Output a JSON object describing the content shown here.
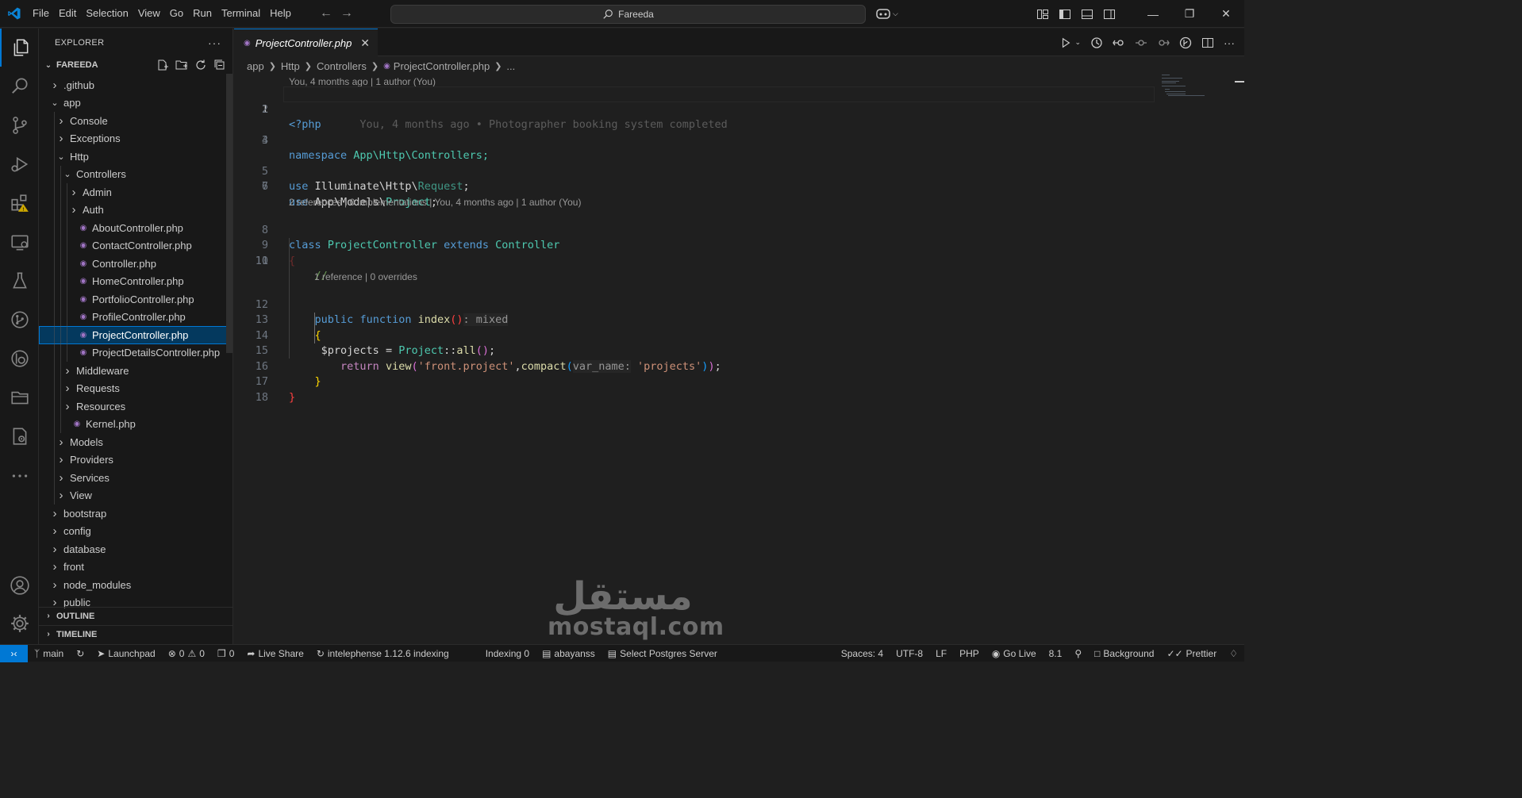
{
  "titlebar": {
    "menu": [
      "File",
      "Edit",
      "Selection",
      "View",
      "Go",
      "Run",
      "Terminal",
      "Help"
    ],
    "search_text": "Fareeda"
  },
  "sidebar": {
    "title": "EXPLORER",
    "root": "FAREEDA",
    "tree": [
      {
        "label": ".github",
        "depth": 1,
        "kind": "folder",
        "open": false
      },
      {
        "label": "app",
        "depth": 1,
        "kind": "folder",
        "open": true
      },
      {
        "label": "Console",
        "depth": 2,
        "kind": "folder",
        "open": false
      },
      {
        "label": "Exceptions",
        "depth": 2,
        "kind": "folder",
        "open": false
      },
      {
        "label": "Http",
        "depth": 2,
        "kind": "folder",
        "open": true
      },
      {
        "label": "Controllers",
        "depth": 3,
        "kind": "folder",
        "open": true
      },
      {
        "label": "Admin",
        "depth": 4,
        "kind": "folder",
        "open": false
      },
      {
        "label": "Auth",
        "depth": 4,
        "kind": "folder",
        "open": false
      },
      {
        "label": "AboutController.php",
        "depth": 4,
        "kind": "php"
      },
      {
        "label": "ContactController.php",
        "depth": 4,
        "kind": "php"
      },
      {
        "label": "Controller.php",
        "depth": 4,
        "kind": "php"
      },
      {
        "label": "HomeController.php",
        "depth": 4,
        "kind": "php"
      },
      {
        "label": "PortfolioController.php",
        "depth": 4,
        "kind": "php"
      },
      {
        "label": "ProfileController.php",
        "depth": 4,
        "kind": "php"
      },
      {
        "label": "ProjectController.php",
        "depth": 4,
        "kind": "php",
        "selected": true
      },
      {
        "label": "ProjectDetailsController.php",
        "depth": 4,
        "kind": "php"
      },
      {
        "label": "Middleware",
        "depth": 3,
        "kind": "folder",
        "open": false
      },
      {
        "label": "Requests",
        "depth": 3,
        "kind": "folder",
        "open": false
      },
      {
        "label": "Resources",
        "depth": 3,
        "kind": "folder",
        "open": false
      },
      {
        "label": "Kernel.php",
        "depth": 3,
        "kind": "php"
      },
      {
        "label": "Models",
        "depth": 2,
        "kind": "folder",
        "open": false
      },
      {
        "label": "Providers",
        "depth": 2,
        "kind": "folder",
        "open": false
      },
      {
        "label": "Services",
        "depth": 2,
        "kind": "folder",
        "open": false
      },
      {
        "label": "View",
        "depth": 2,
        "kind": "folder",
        "open": false
      },
      {
        "label": "bootstrap",
        "depth": 1,
        "kind": "folder",
        "open": false
      },
      {
        "label": "config",
        "depth": 1,
        "kind": "folder",
        "open": false
      },
      {
        "label": "database",
        "depth": 1,
        "kind": "folder",
        "open": false
      },
      {
        "label": "front",
        "depth": 1,
        "kind": "folder",
        "open": false
      },
      {
        "label": "node_modules",
        "depth": 1,
        "kind": "folder",
        "open": false
      },
      {
        "label": "public",
        "depth": 1,
        "kind": "folder",
        "open": false
      }
    ],
    "outline": "OUTLINE",
    "timeline": "TIMELINE"
  },
  "editor": {
    "tab_label": "ProjectController.php",
    "breadcrumbs": [
      "app",
      "Http",
      "Controllers",
      "ProjectController.php",
      "..."
    ],
    "lens_top": "You, 4 months ago | 1 author (You)",
    "blame_line1": "You, 4 months ago • Photographer booking system completed",
    "lens_class": "2 references | 0 implementations | You, 4 months ago | 1 author (You)",
    "lens_method": "1 reference | 0 overrides",
    "line_numbers": [
      "1",
      "2",
      "3",
      "4",
      "5",
      "6",
      "7",
      "8",
      "9",
      "10",
      "11",
      "12",
      "13",
      "14",
      "15",
      "16",
      "17",
      "18"
    ],
    "code": {
      "l1": "<?php",
      "l3_kw": "namespace",
      "l3_ns": "App\\Http\\Controllers;",
      "l5_kw": "use",
      "l5_ns": "Illuminate\\Http\\",
      "l5_cls": "Request",
      "l6_kw": "use",
      "l6_ns": "App\\Models\\",
      "l6_cls": "Project",
      "l8_kw": "class",
      "l8_cls": "ProjectController",
      "l8_kw2": "extends",
      "l8_cls2": "Controller",
      "l10_cmt": "//",
      "l12_kw1": "public",
      "l12_kw2": "function",
      "l12_fn": "index",
      "l12_hint": ": mixed",
      "l14_var": "$projects",
      "l14_cls": "Project",
      "l14_fn": "all",
      "l15_kw": "return",
      "l15_fn": "view",
      "l15_str": "'front.project'",
      "l15_fn2": "compact",
      "l15_hint": "var_name:",
      "l15_str2": "'projects'"
    }
  },
  "watermark": {
    "arabic": "مستقل",
    "latin": "mostaql.com"
  },
  "statusbar": {
    "branch": "main",
    "launchpad": "Launchpad",
    "errors": "0",
    "warnings": "0",
    "ports": "0",
    "liveshare": "Live Share",
    "indexing": "intelephense 1.12.6 indexing",
    "indexing2": "Indexing 0",
    "user": "abayanss",
    "postgres": "Select Postgres Server",
    "spaces": "Spaces: 4",
    "encoding": "UTF-8",
    "eol": "LF",
    "lang": "PHP",
    "golive": "Go Live",
    "version": "8.1",
    "background": "Background",
    "prettier": "Prettier"
  }
}
